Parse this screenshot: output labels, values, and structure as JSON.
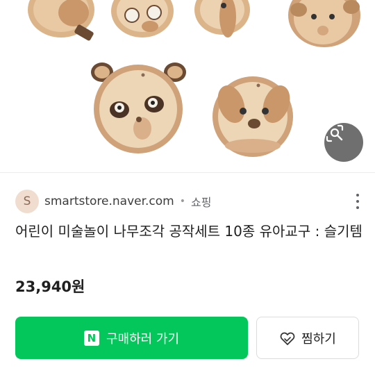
{
  "source": {
    "favicon_letter": "S",
    "domain": "smartstore.naver.com",
    "separator": "•",
    "category": "쇼핑"
  },
  "product": {
    "title": "어린이 미술놀이 나무조각 공작세트 10종 유아교구 : 슬기템",
    "price": "23,940원"
  },
  "actions": {
    "buy_logo": "N",
    "buy_label": "구매하러 가기",
    "save_label": "찜하기"
  },
  "colors": {
    "brand_green": "#03c75a",
    "lens_button": "#6f6f6f",
    "wood": "#dcb48a"
  },
  "icons": {
    "image_search": "lens-search-icon",
    "more": "more-vertical-icon",
    "save": "heart-outline-icon"
  }
}
